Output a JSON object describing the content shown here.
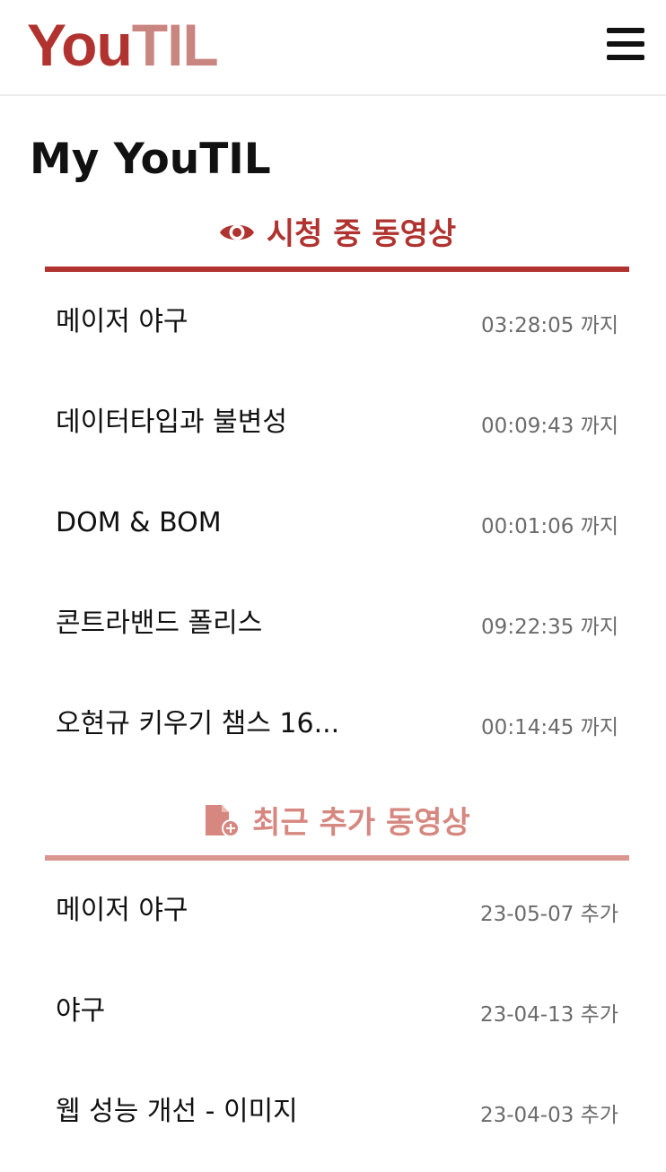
{
  "header": {
    "logo_you": "You",
    "logo_til": "TIL",
    "menu_icon": "hamburger-menu-icon"
  },
  "page_title": "My YouTIL",
  "colors": {
    "primary": "#b0332f",
    "primary_light": "#d6877f",
    "meta_text": "#6b6b6b"
  },
  "watching": {
    "icon": "eye-icon",
    "label": "시청 중 동영상",
    "items": [
      {
        "title": "메이저 야구",
        "time": "03:28:05",
        "suffix": "까지"
      },
      {
        "title": "데이터타입과 불변성",
        "time": "00:09:43",
        "suffix": "까지"
      },
      {
        "title": "DOM & BOM",
        "time": "00:01:06",
        "suffix": "까지"
      },
      {
        "title": "콘트라밴드 폴리스",
        "time": "09:22:35",
        "suffix": "까지"
      },
      {
        "title": "오현규 키우기 챔스 16...",
        "time": "00:14:45",
        "suffix": "까지"
      }
    ]
  },
  "recent": {
    "icon": "file-add-icon",
    "label": "최근 추가 동영상",
    "items": [
      {
        "title": "메이저 야구",
        "date": "23-05-07",
        "suffix": "추가"
      },
      {
        "title": "야구",
        "date": "23-04-13",
        "suffix": "추가"
      },
      {
        "title": "웹 성능 개선 - 이미지",
        "date": "23-04-03",
        "suffix": "추가"
      }
    ]
  }
}
